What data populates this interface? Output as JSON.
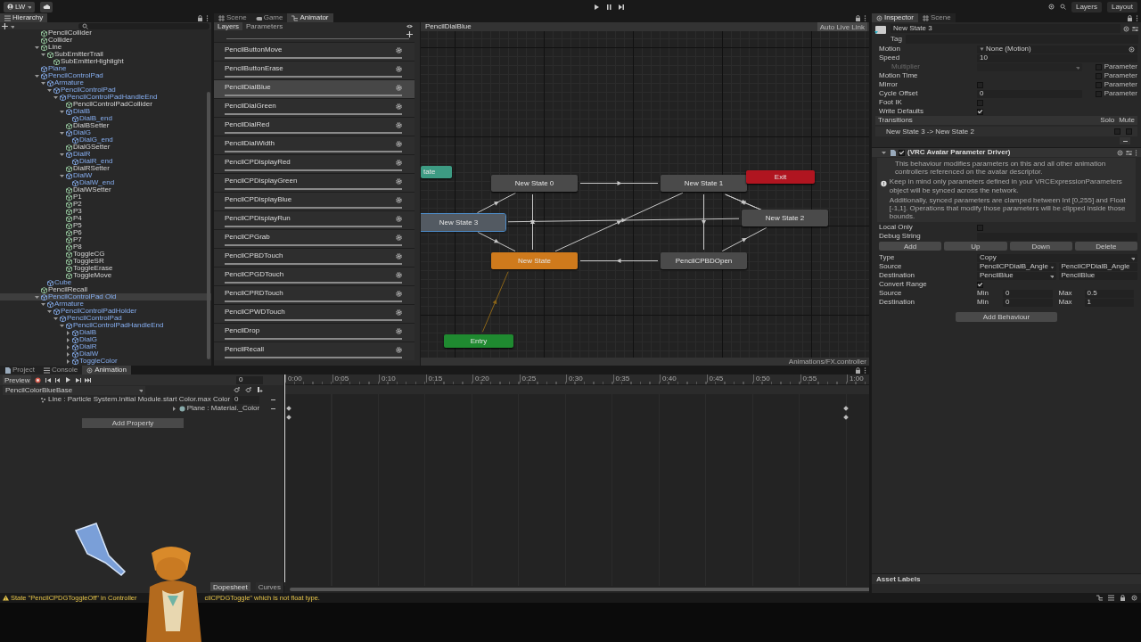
{
  "toolbar": {
    "account": "LW",
    "right_buttons": [
      "Layers",
      "Layout"
    ]
  },
  "hierarchy": {
    "title": "Hierarchy",
    "items": [
      {
        "name": "PencilCollider",
        "prefab": false,
        "selected": false
      },
      {
        "name": "Collider",
        "prefab": false,
        "selected": false
      },
      {
        "name": "Line",
        "prefab": false,
        "expanded": true,
        "selected": false,
        "children": [
          {
            "name": "SubEmitterTrail",
            "prefab": false,
            "expanded": true,
            "selected": false,
            "children": [
              {
                "name": "SubEmitterHighlight",
                "prefab": false,
                "selected": false
              }
            ]
          }
        ]
      },
      {
        "name": "Plane",
        "prefab": true,
        "selected": false
      },
      {
        "name": "PencilControlPad",
        "prefab": true,
        "expanded": true,
        "selected": false,
        "children": [
          {
            "name": "Armature",
            "prefab": true,
            "expanded": true,
            "selected": false,
            "children": [
              {
                "name": "PencilControlPad",
                "prefab": true,
                "expanded": true,
                "selected": false,
                "children": [
                  {
                    "name": "PencilControlPadHandleEnd",
                    "prefab": true,
                    "expanded": true,
                    "selected": false,
                    "children": [
                      {
                        "name": "PencilControlPadCollider",
                        "prefab": false,
                        "selected": false
                      },
                      {
                        "name": "DialB",
                        "prefab": true,
                        "expanded": true,
                        "selected": false,
                        "children": [
                          {
                            "name": "DialB_end",
                            "prefab": true,
                            "selected": false
                          }
                        ]
                      },
                      {
                        "name": "DialBSetter",
                        "prefab": false,
                        "selected": false
                      },
                      {
                        "name": "DialG",
                        "prefab": true,
                        "expanded": true,
                        "selected": false,
                        "children": [
                          {
                            "name": "DialG_end",
                            "prefab": true,
                            "selected": false
                          }
                        ]
                      },
                      {
                        "name": "DialGSetter",
                        "prefab": false,
                        "selected": false
                      },
                      {
                        "name": "DialR",
                        "prefab": true,
                        "expanded": true,
                        "selected": false,
                        "children": [
                          {
                            "name": "DialR_end",
                            "prefab": true,
                            "selected": false
                          }
                        ]
                      },
                      {
                        "name": "DialRSetter",
                        "prefab": false,
                        "selected": false
                      },
                      {
                        "name": "DialW",
                        "prefab": true,
                        "expanded": true,
                        "selected": false,
                        "children": [
                          {
                            "name": "DialW_end",
                            "prefab": true,
                            "selected": false
                          }
                        ]
                      },
                      {
                        "name": "DialWSetter",
                        "prefab": false,
                        "selected": false
                      },
                      {
                        "name": "P1",
                        "prefab": false,
                        "selected": false
                      },
                      {
                        "name": "P2",
                        "prefab": false,
                        "selected": false
                      },
                      {
                        "name": "P3",
                        "prefab": false,
                        "selected": false
                      },
                      {
                        "name": "P4",
                        "prefab": false,
                        "selected": false
                      },
                      {
                        "name": "P5",
                        "prefab": false,
                        "selected": false
                      },
                      {
                        "name": "P6",
                        "prefab": false,
                        "selected": false
                      },
                      {
                        "name": "P7",
                        "prefab": false,
                        "selected": false
                      },
                      {
                        "name": "P8",
                        "prefab": false,
                        "selected": false
                      },
                      {
                        "name": "ToggleCG",
                        "prefab": false,
                        "selected": false
                      },
                      {
                        "name": "ToggleSR",
                        "prefab": false,
                        "selected": false
                      },
                      {
                        "name": "ToggleErase",
                        "prefab": false,
                        "selected": false
                      },
                      {
                        "name": "ToggleMove",
                        "prefab": false,
                        "selected": false
                      }
                    ]
                  }
                ]
              }
            ]
          },
          {
            "name": "Cube",
            "prefab": true,
            "selected": false
          }
        ]
      },
      {
        "name": "PencilRecall",
        "prefab": false,
        "selected": false
      },
      {
        "name": "PencilControlPad Old",
        "prefab": true,
        "expanded": true,
        "selected": true,
        "children": [
          {
            "name": "Armature",
            "prefab": true,
            "expanded": true,
            "selected": false,
            "children": [
              {
                "name": "PencilControlPadHolder",
                "prefab": true,
                "expanded": true,
                "selected": false,
                "children": [
                  {
                    "name": "PencilControlPad",
                    "prefab": true,
                    "expanded": true,
                    "selected": false,
                    "children": [
                      {
                        "name": "PencilControlPadHandleEnd",
                        "prefab": true,
                        "expanded": true,
                        "selected": false,
                        "children": [
                          {
                            "name": "DialB",
                            "prefab": true,
                            "expanded": false,
                            "selected": false
                          },
                          {
                            "name": "DialG",
                            "prefab": true,
                            "expanded": false,
                            "selected": false
                          },
                          {
                            "name": "DialR",
                            "prefab": true,
                            "expanded": false,
                            "selected": false
                          },
                          {
                            "name": "DialW",
                            "prefab": true,
                            "expanded": false,
                            "selected": false
                          },
                          {
                            "name": "ToggleColor",
                            "prefab": true,
                            "expanded": false,
                            "selected": false
                          }
                        ]
                      }
                    ]
                  }
                ]
              }
            ]
          }
        ]
      }
    ]
  },
  "animator": {
    "tabs": [
      {
        "label": "Scene",
        "selected": false
      },
      {
        "label": "Game",
        "selected": false
      },
      {
        "label": "Animator",
        "selected": true
      }
    ],
    "subtabs": [
      {
        "label": "Layers",
        "selected": true
      },
      {
        "label": "Parameters",
        "selected": false
      }
    ],
    "layers": [
      {
        "name": "PencilButtonMove",
        "selected": false,
        "level": 1
      },
      {
        "name": "PencilButtonErase",
        "selected": false,
        "level": 1
      },
      {
        "name": "PencilDialBlue",
        "selected": true,
        "level": 1
      },
      {
        "name": "PencilDialGreen",
        "selected": false,
        "level": 1
      },
      {
        "name": "PencilDialRed",
        "selected": false,
        "level": 1
      },
      {
        "name": "PencilDialWidth",
        "selected": false,
        "level": 1
      },
      {
        "name": "PencilCPDisplayRed",
        "selected": false,
        "level": 1
      },
      {
        "name": "PencilCPDisplayGreen",
        "selected": false,
        "level": 1
      },
      {
        "name": "PencilCPDisplayBlue",
        "selected": false,
        "level": 1
      },
      {
        "name": "PencilCPDisplayRun",
        "selected": false,
        "level": 1
      },
      {
        "name": "PencilCPGrab",
        "selected": false,
        "level": 1
      },
      {
        "name": "PencilCPBDTouch",
        "selected": false,
        "level": 1
      },
      {
        "name": "PencilCPGDTouch",
        "selected": false,
        "level": 1
      },
      {
        "name": "PencilCPRDTouch",
        "selected": false,
        "level": 1
      },
      {
        "name": "PencilCPWDTouch",
        "selected": false,
        "level": 1
      },
      {
        "name": "PencilDrop",
        "selected": false,
        "level": 1
      },
      {
        "name": "PencilRecall",
        "selected": false,
        "level": 1
      }
    ],
    "breadcrumb": "PencilDialBlue",
    "live_link": "Auto Live Link",
    "footer": "Animations/FX.controller",
    "nodes": [
      {
        "label": "tate",
        "kind": "any",
        "selected": false
      },
      {
        "label": "New State 0",
        "kind": "state",
        "selected": false
      },
      {
        "label": "New State 1",
        "kind": "state",
        "selected": false
      },
      {
        "label": "Exit",
        "kind": "exit",
        "selected": false
      },
      {
        "label": "New State 2",
        "kind": "state",
        "selected": false
      },
      {
        "label": "New State 3",
        "kind": "state",
        "selected": true
      },
      {
        "label": "New State",
        "kind": "default",
        "selected": false
      },
      {
        "label": "PencilCPBDOpen",
        "kind": "state",
        "selected": false
      },
      {
        "label": "Entry",
        "kind": "entry",
        "selected": false
      }
    ]
  },
  "inspector": {
    "tabs": [
      {
        "label": "Inspector",
        "selected": true
      },
      {
        "label": "Scene",
        "selected": false
      }
    ],
    "name": "New State 3",
    "tag_label": "Tag",
    "fields": [
      {
        "label": "Motion",
        "kind": "object",
        "value": "None (Motion)",
        "disabled": false
      },
      {
        "label": "Speed",
        "kind": "text",
        "value": "10",
        "disabled": false
      },
      {
        "label": "Multiplier",
        "kind": "dropdown",
        "disabled": true,
        "parameter": {
          "label": "Parameter",
          "checked": false
        }
      },
      {
        "label": "Motion Time",
        "kind": "empty",
        "disabled": false,
        "parameter": {
          "label": "Parameter",
          "checked": false
        }
      },
      {
        "label": "Mirror",
        "kind": "checkbox",
        "checked": false,
        "disabled": false,
        "parameter": {
          "label": "Parameter",
          "checked": false
        }
      },
      {
        "label": "Cycle Offset",
        "kind": "text",
        "value": "0",
        "disabled": false,
        "parameter": {
          "label": "Parameter",
          "checked": false
        }
      },
      {
        "label": "Foot IK",
        "kind": "checkbox",
        "checked": false,
        "disabled": false
      },
      {
        "label": "Write Defaults",
        "kind": "checkbox",
        "checked": true,
        "disabled": false
      }
    ],
    "transitions": {
      "title": "Transitions",
      "solo": "Solo",
      "mute": "Mute",
      "rows": [
        {
          "label": "New State 3 -> New State 2",
          "solo": false,
          "mute": false
        }
      ]
    },
    "driver": {
      "title": "(VRC Avatar Parameter Driver)",
      "enabled": true,
      "info": "This behaviour modifies parameters on this and all other animation controllers referenced on the avatar descriptor.",
      "warning": [
        "Keep in mind only parameters defined in your VRCExpressionParameters object will be synced across the network.",
        "Additionally, synced parameters are clamped between Int [0,255] and Float [-1,1]. Operations that modify those parameters will be clipped inside those bounds."
      ],
      "fields": [
        {
          "label": "Local Only",
          "kind": "checkbox",
          "checked": false
        },
        {
          "label": "Debug String",
          "kind": "text"
        }
      ],
      "buttons": [
        "Add",
        "Up",
        "Down",
        "Delete"
      ],
      "params": [
        {
          "label": "Type",
          "kind": "dropdown",
          "value": "Copy"
        },
        {
          "label": "Source",
          "kind": "pair",
          "value": "PencilCPDialB_Angle",
          "text": "PencilCPDialB_Angle"
        },
        {
          "label": "Destination",
          "kind": "pair",
          "value": "PencilBlue",
          "text": "PencilBlue"
        },
        {
          "label": "Convert Range",
          "kind": "checkbox",
          "checked": true
        },
        {
          "label": "Source",
          "kind": "range",
          "min_label": "Min",
          "min": "0",
          "max_label": "Max",
          "max": "0.5"
        },
        {
          "label": "Destination",
          "kind": "range",
          "min_label": "Min",
          "min": "0",
          "max_label": "Max",
          "max": "1"
        }
      ]
    },
    "add_behaviour": "Add Behaviour",
    "asset_labels": "Asset Labels"
  },
  "animation": {
    "tabs": [
      {
        "label": "Project",
        "selected": false
      },
      {
        "label": "Console",
        "selected": false
      },
      {
        "label": "Animation",
        "selected": true
      }
    ],
    "preview": "Preview",
    "frame": "0",
    "clip": "PencilColorBlueBase",
    "properties": [
      {
        "label": "Line : Particle System.Initial Module.start Color.max Color",
        "value": "0"
      },
      {
        "label": "Plane : Material._Color",
        "expanded": false
      }
    ],
    "add_property": "Add Property",
    "ruler": [
      "0:00",
      "0:05",
      "0:10",
      "0:15",
      "0:20",
      "0:25",
      "0:30",
      "0:35",
      "0:40",
      "0:45",
      "0:50",
      "0:55",
      "1:00"
    ],
    "view_tabs": [
      {
        "label": "Dopesheet",
        "selected": true
      },
      {
        "label": "Curves",
        "selected": false
      }
    ]
  },
  "status_bar": {
    "message_parts": [
      "State \"PencilCPDGToggleOff\" in Controller",
      "cilCPDGToggle\" which is not float type."
    ]
  }
}
